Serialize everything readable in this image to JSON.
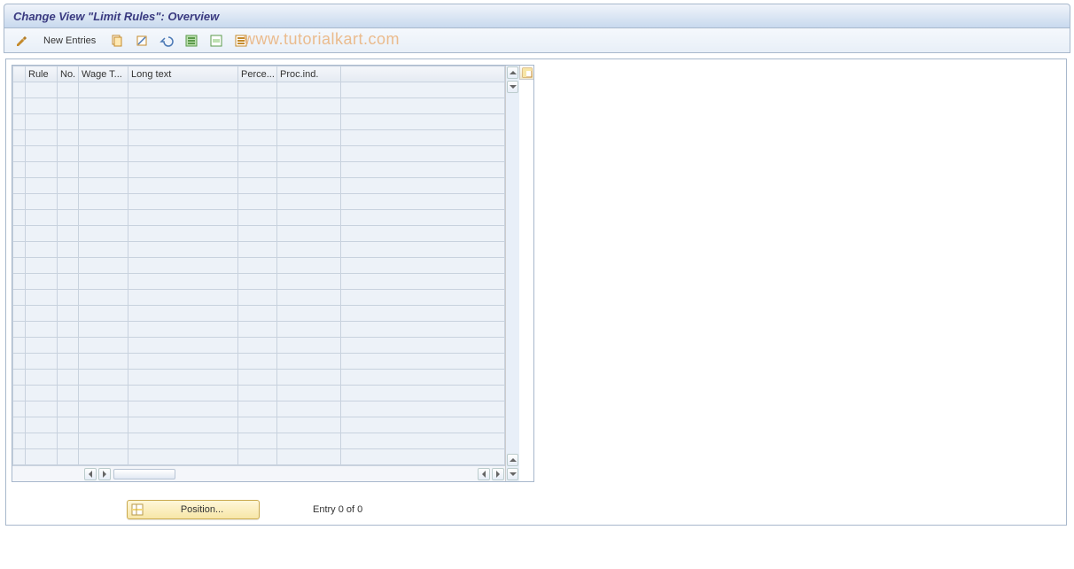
{
  "title": "Change View \"Limit Rules\": Overview",
  "watermark": "www.tutorialkart.com",
  "toolbar": {
    "change_icon": "pencils-icon",
    "new_entries_label": "New Entries",
    "copy_icon": "copy-icon",
    "delete_icon": "delete-icon",
    "undo_icon": "undo-icon",
    "select_all_icon": "select-all-icon",
    "select_block_icon": "select-block-icon",
    "deselect_icon": "deselect-all-icon"
  },
  "table": {
    "columns": {
      "rule": "Rule",
      "no": "No.",
      "wage": "Wage T...",
      "long": "Long text",
      "perc": "Perce...",
      "proc": "Proc.ind."
    },
    "row_count": 24,
    "rows": []
  },
  "footer": {
    "position_label": "Position...",
    "entry_text": "Entry 0 of 0"
  }
}
